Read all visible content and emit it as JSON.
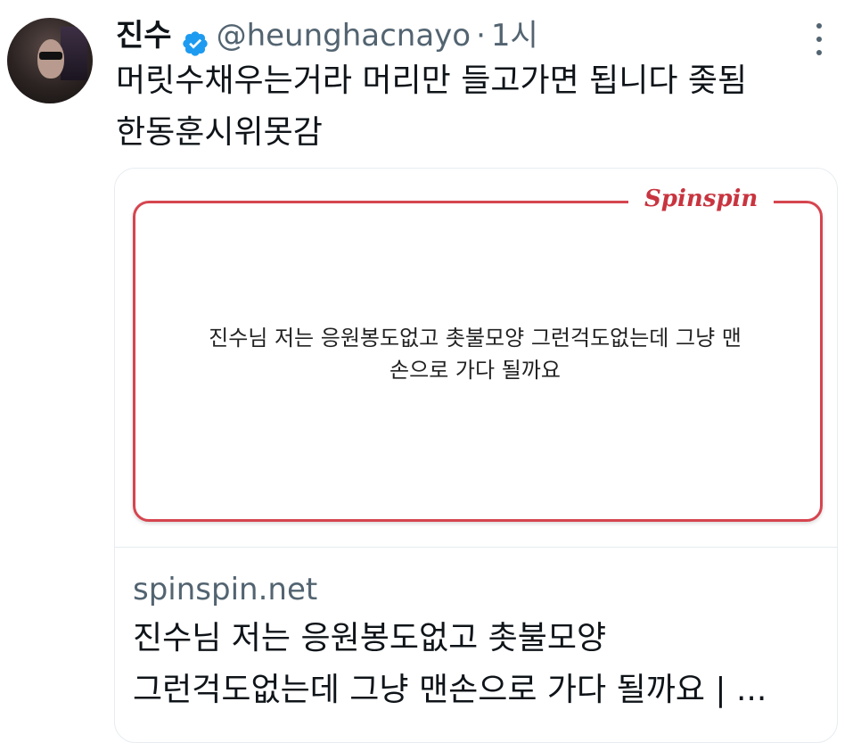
{
  "tweet": {
    "author_name": "진수",
    "handle": "@heunghacnayo",
    "separator": "·",
    "time": "1시",
    "verified": true,
    "text_lines": [
      "머릿수채우는거라 머리만 들고가면 됩니다 좆됨",
      "한동훈시위못감"
    ]
  },
  "card": {
    "brand": "Spinspin",
    "quote_lines": [
      "진수님 저는 응원봉도없고 촛불모양 그런걱도없는데 그냥 맨",
      "손으로 가다 될까요"
    ],
    "domain": "spinspin.net",
    "title_lines": [
      "진수님 저는 응원봉도없고 촛불모양",
      "그런걱도없는데 그냥 맨손으로 가다 될까요 | ..."
    ]
  },
  "colors": {
    "accent_blue": "#1d9bf0",
    "brand_red": "#c8343f",
    "secondary_text": "#536471"
  },
  "icons": {
    "verified": "verified-badge-icon",
    "more": "more-options-icon"
  }
}
